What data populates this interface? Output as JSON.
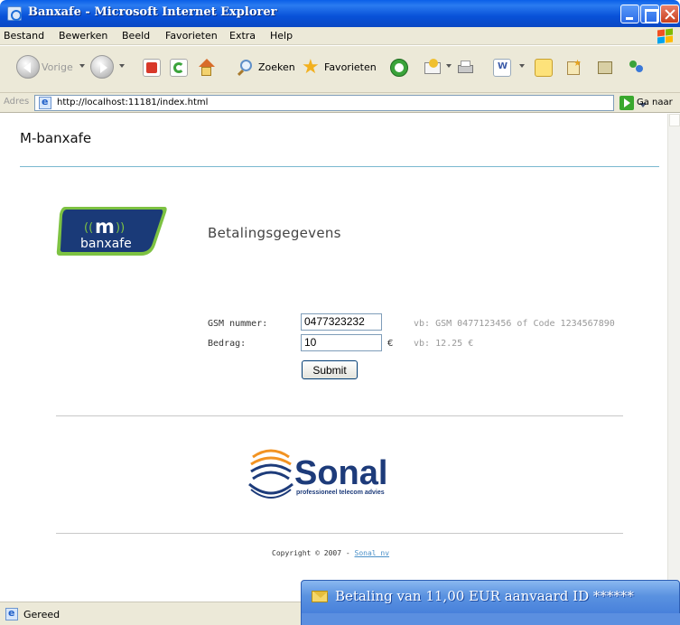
{
  "window": {
    "title": "Banxafe - Microsoft Internet Explorer"
  },
  "menu": {
    "items": [
      "Bestand",
      "Bewerken",
      "Beeld",
      "Favorieten",
      "Extra",
      "Help"
    ]
  },
  "toolbar": {
    "back_label": "Vorige",
    "search_label": "Zoeken",
    "favorites_label": "Favorieten"
  },
  "address": {
    "label": "Adres",
    "url": "http://localhost:11181/index.html",
    "go_label": "Ga naar"
  },
  "page": {
    "site_title": "M-banxafe",
    "heading": "Betalingsgegevens",
    "logo_m": {
      "mark": "m",
      "wordmark": "banxafe"
    },
    "form": {
      "gsm_label": "GSM nummer:",
      "gsm_value": "0477323232",
      "gsm_hint": "vb: GSM 0477123456 of Code 1234567890",
      "amount_label": "Bedrag:",
      "amount_value": "10",
      "currency": "€",
      "amount_hint": "vb: 12.25 €",
      "submit_label": "Submit"
    },
    "sonal_logo": {
      "name": "Sonal",
      "tagline": "professioneel telecom advies"
    },
    "copyright": {
      "text": "Copyright © 2007 - ",
      "link": "Sonal nv"
    }
  },
  "status": {
    "text": "Gereed"
  },
  "notification": {
    "message": "Betaling van 11,00 EUR aanvaard ID ******"
  },
  "colors": {
    "titlebar": "#0a5fe8",
    "chrome": "#ece9d8",
    "logo_green": "#7dc242",
    "logo_navy": "#1a3a78",
    "sonal_orange": "#f29322",
    "sonal_navy": "#1d3b7a",
    "hint": "#999999",
    "rule_accent": "#7ab8cf"
  }
}
